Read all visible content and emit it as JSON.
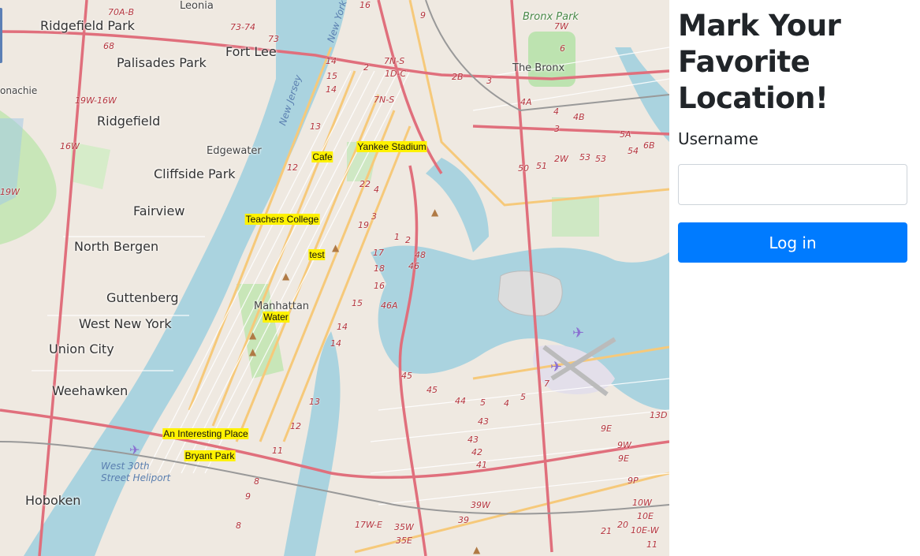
{
  "panel": {
    "title": "Mark Your Favorite Location!",
    "username_label": "Username",
    "username_value": "",
    "login_label": "Log in",
    "accent_color": "#007bff"
  },
  "map": {
    "marker_color": "#ffff00",
    "places": {
      "bronx_park": "Bronx Park",
      "leonia": "Leonia",
      "ridgefield_park": "Ridgefield Park",
      "palisades_park": "Palisades Park",
      "fort_lee": "Fort Lee",
      "the_bronx": "The Bronx",
      "bonachie": "onachie",
      "ridgefield": "Ridgefield",
      "edgewater": "Edgewater",
      "cliffside_park": "Cliffside Park",
      "fairview": "Fairview",
      "north_bergen": "North Bergen",
      "guttenberg": "Guttenberg",
      "west_new_york": "West New York",
      "union_city": "Union City",
      "weehawken": "Weehawken",
      "hoboken": "Hoboken",
      "manhattan": "Manhattan",
      "new_jersey_water": "New Jersey",
      "new_york_water": "New York",
      "west_30th_heliport": "West 30th Street Heliport"
    },
    "road_numbers": [
      "70A-B",
      "73-74",
      "73",
      "16",
      "9",
      "7W",
      "6",
      "68",
      "14",
      "7N-S",
      "1D-C",
      "2B",
      "3",
      "2",
      "15",
      "19W-16W",
      "14",
      "7N-S",
      "4A",
      "4",
      "4B",
      "3",
      "16W",
      "13",
      "5A",
      "53",
      "54",
      "6B",
      "12",
      "22",
      "4",
      "2W",
      "53",
      "51",
      "50",
      "19W",
      "3",
      "19",
      "1",
      "2",
      "17",
      "48",
      "46",
      "18",
      "16",
      "15",
      "46A",
      "14",
      "14",
      "45",
      "45",
      "44",
      "5",
      "4",
      "5",
      "7",
      "13",
      "43",
      "43",
      "42",
      "41",
      "39W",
      "39",
      "35W",
      "35E",
      "17W-E",
      "8",
      "9",
      "8",
      "13D",
      "9E",
      "9W",
      "9E",
      "9P",
      "10W",
      "10E",
      "10E-W",
      "20",
      "21",
      "11",
      "8",
      "12",
      "11"
    ],
    "markers": [
      {
        "label": "Yankee Stadium"
      },
      {
        "label": "Cafe"
      },
      {
        "label": "Teachers College"
      },
      {
        "label": "test"
      },
      {
        "label": "Water"
      },
      {
        "label": "An Interesting Place"
      },
      {
        "label": "Bryant Park"
      }
    ]
  }
}
